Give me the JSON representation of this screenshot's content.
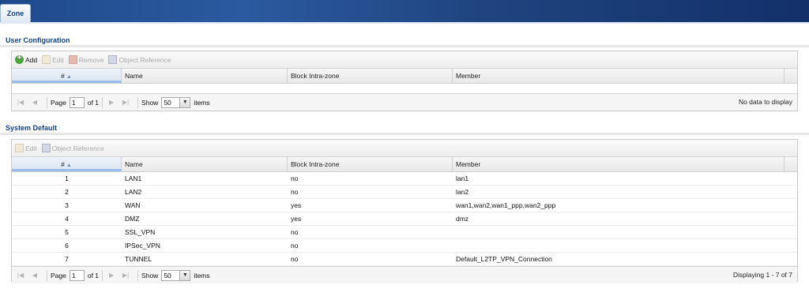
{
  "header": {
    "tab_label": "Zone"
  },
  "user_configuration": {
    "title": "User Configuration",
    "toolbar": {
      "add": "Add",
      "edit": "Edit",
      "remove": "Remove",
      "object_reference": "Object Reference"
    },
    "columns": {
      "num": "#",
      "name": "Name",
      "block": "Block Intra-zone",
      "member": "Member"
    },
    "rows": [],
    "pager": {
      "page_label": "Page",
      "page_value": "1",
      "of_label": "of 1",
      "show_label": "Show",
      "show_value": "50",
      "items_label": "items",
      "status": "No data to display"
    }
  },
  "system_default": {
    "title": "System Default",
    "toolbar": {
      "edit": "Edit",
      "object_reference": "Object Reference"
    },
    "columns": {
      "num": "#",
      "name": "Name",
      "block": "Block Intra-zone",
      "member": "Member"
    },
    "rows": [
      {
        "num": "1",
        "name": "LAN1",
        "block": "no",
        "member": "lan1"
      },
      {
        "num": "2",
        "name": "LAN2",
        "block": "no",
        "member": "lan2"
      },
      {
        "num": "3",
        "name": "WAN",
        "block": "yes",
        "member": "wan1,wan2,wan1_ppp,wan2_ppp"
      },
      {
        "num": "4",
        "name": "DMZ",
        "block": "yes",
        "member": "dmz"
      },
      {
        "num": "5",
        "name": "SSL_VPN",
        "block": "no",
        "member": ""
      },
      {
        "num": "6",
        "name": "IPSec_VPN",
        "block": "no",
        "member": ""
      },
      {
        "num": "7",
        "name": "TUNNEL",
        "block": "no",
        "member": "Default_L2TP_VPN_Connection"
      }
    ],
    "pager": {
      "page_label": "Page",
      "page_value": "1",
      "of_label": "of 1",
      "show_label": "Show",
      "show_value": "50",
      "items_label": "items",
      "status": "Displaying 1 - 7 of 7"
    }
  }
}
